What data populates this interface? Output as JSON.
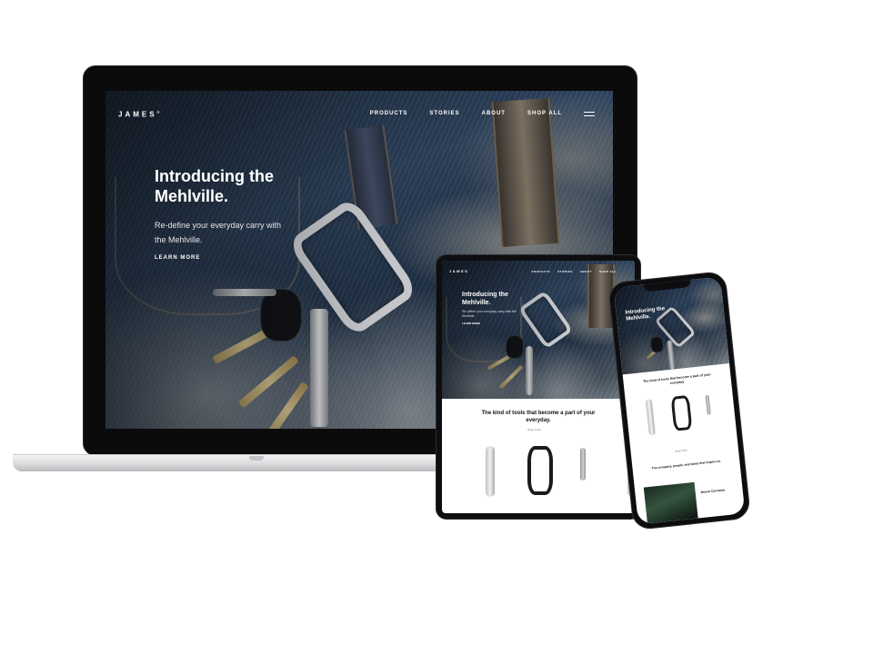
{
  "site": {
    "logo": "JAMES",
    "logo_mark": "®",
    "nav": [
      "PRODUCTS",
      "STORIES",
      "ABOUT",
      "SHOP ALL"
    ]
  },
  "hero": {
    "title": "Introducing the Mehlville.",
    "subtitle": "Re-define your everyday carry with the Mehlville.",
    "cta": "LEARN MORE"
  },
  "products_section": {
    "heading": "The kind of tools that become a part of your everyday.",
    "link": "Shop Tools"
  },
  "phone_extra": {
    "section_heading": "The company, people, and ideas that inspire us",
    "card_title": "Mount Carroway"
  },
  "colors": {
    "device_bezel": "#0b0b0c",
    "background": "#ffffff",
    "hero_text": "#ffffff"
  },
  "icons": [
    "menu-icon"
  ]
}
